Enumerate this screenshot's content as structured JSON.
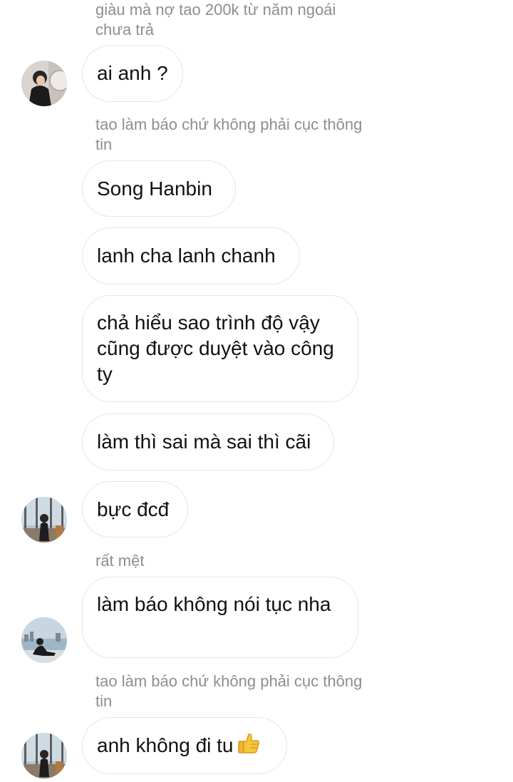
{
  "chat": {
    "reply_1": "giàu mà nợ tao 200k từ năm ngoái chưa trả",
    "msg_1": "ai anh ?",
    "reply_2": "tao làm báo chứ không phải cục thông tin",
    "msg_2": "Song Hanbin",
    "msg_3": "lanh cha lanh chanh",
    "msg_4": "chả hiểu sao trình độ vậy cũng được duyệt vào công ty",
    "msg_5": "làm thì sai mà sai thì cãi",
    "msg_6": "bực đcđ",
    "reply_3": "rất mệt",
    "msg_7": "làm báo không nói tục nha",
    "reply_4": "tao làm báo chứ không phải cục thông tin",
    "msg_8": "anh không đi tu",
    "msg_8_emoji": "thumbs-up-icon"
  }
}
